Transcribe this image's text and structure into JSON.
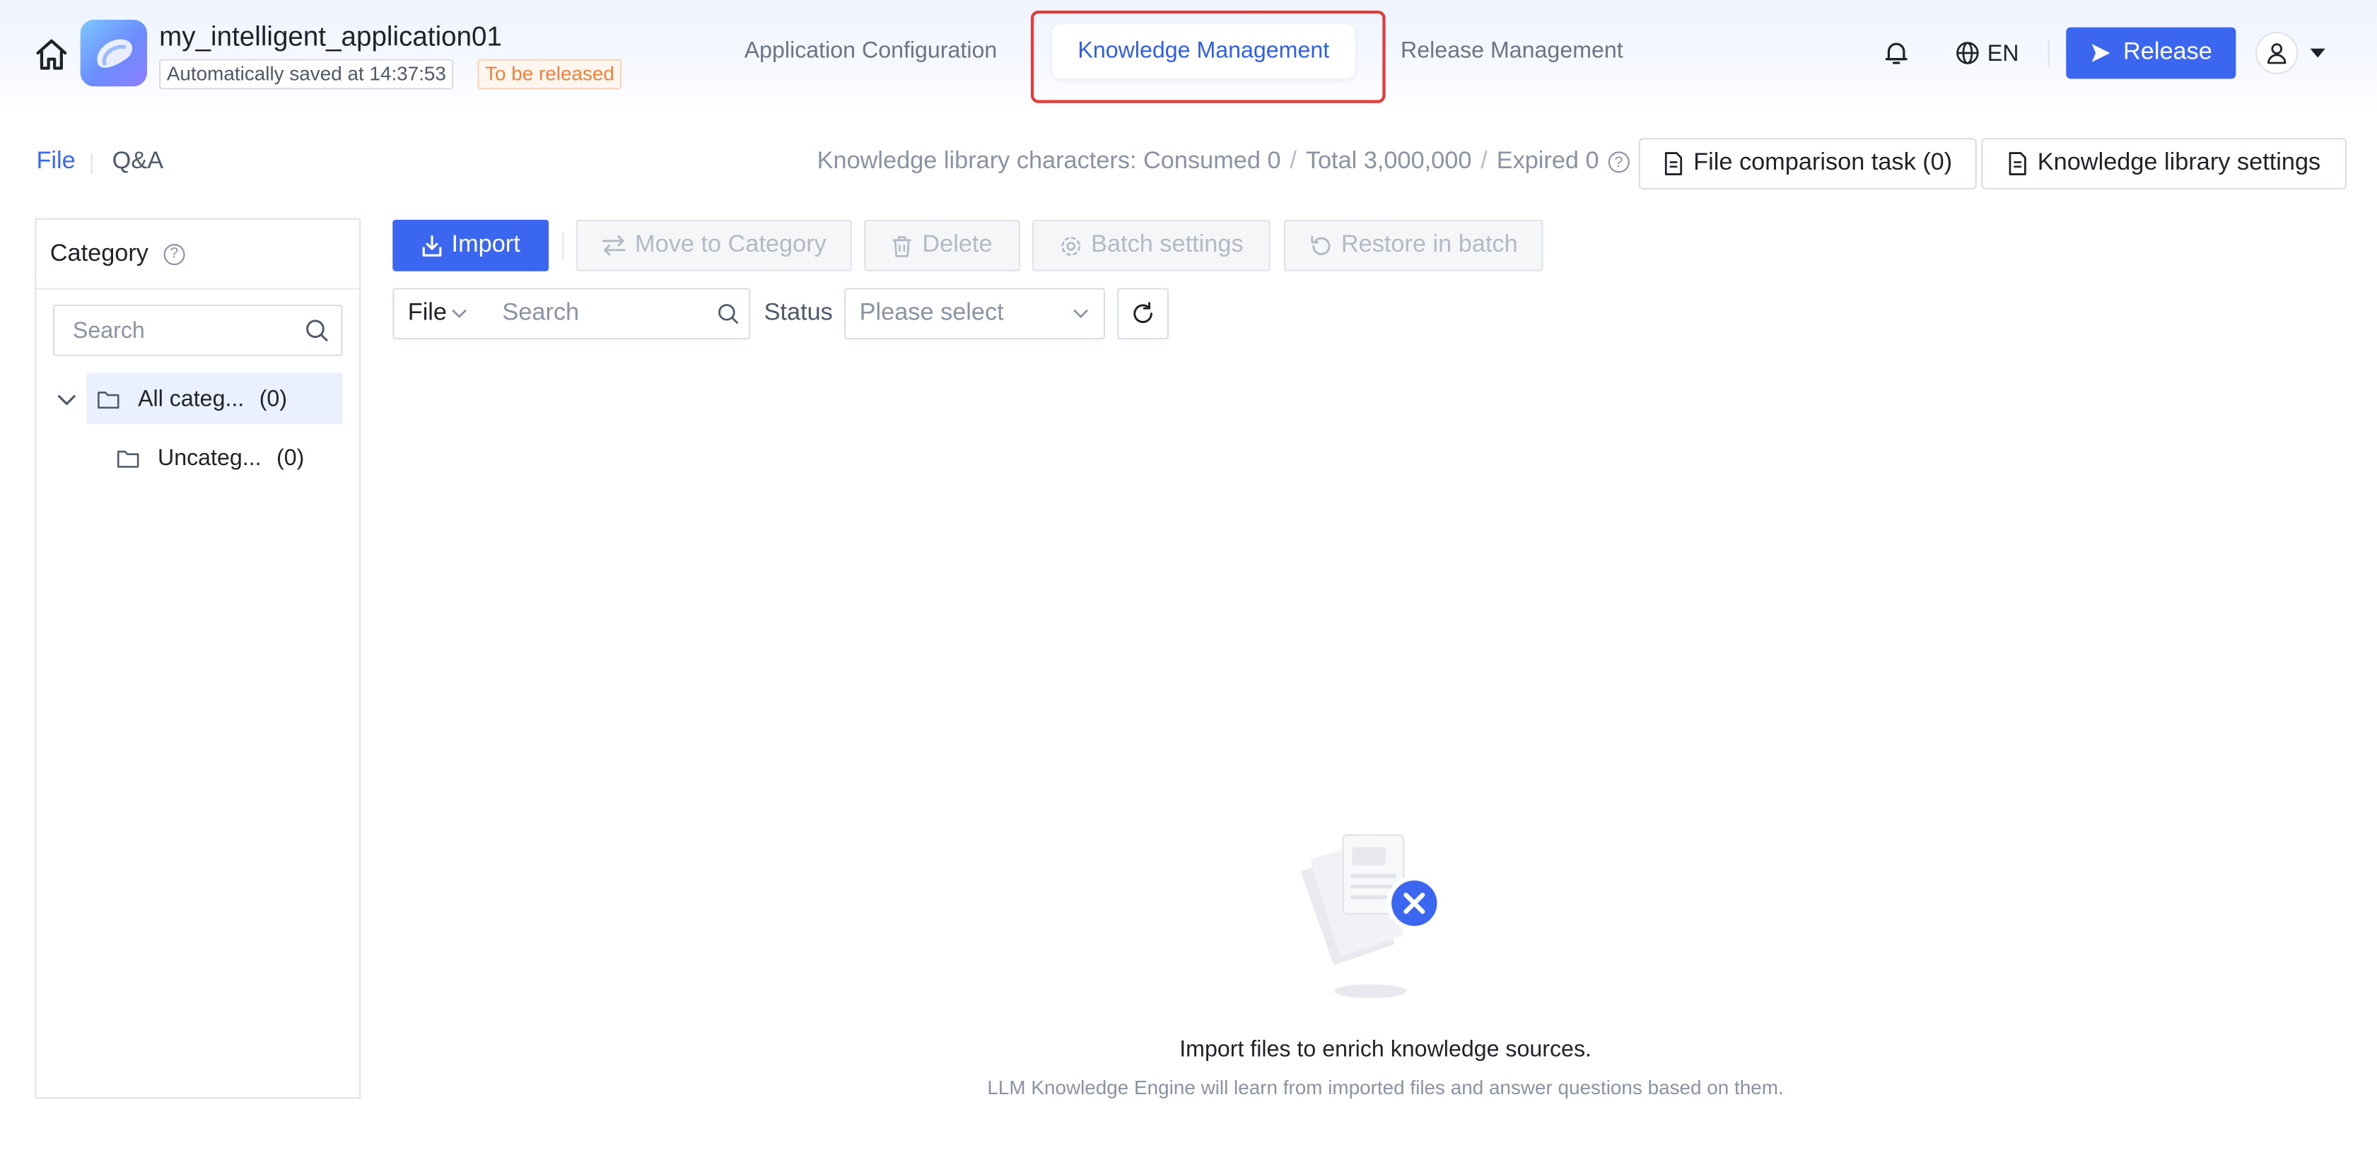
{
  "header": {
    "app_name": "my_intelligent_application01",
    "saved_status": "Automatically saved at 14:37:53",
    "release_status": "To be released",
    "tabs": [
      {
        "label": "Application Configuration",
        "active": false
      },
      {
        "label": "Knowledge Management",
        "active": true
      },
      {
        "label": "Release Management",
        "active": false
      }
    ],
    "language": "EN",
    "release_button": "Release"
  },
  "subheader": {
    "tabs": [
      {
        "label": "File",
        "active": true
      },
      {
        "label": "Q&A",
        "active": false
      }
    ],
    "usage": {
      "consumed": "Knowledge library characters: Consumed 0",
      "total": "Total 3,000,000",
      "expired": "Expired 0"
    },
    "file_comparison_button": "File comparison task (0)",
    "library_settings_button": "Knowledge library settings"
  },
  "category": {
    "title": "Category",
    "search_placeholder": "Search",
    "tree": [
      {
        "label": "All categ...",
        "count": "(0)",
        "expanded": true,
        "selected": true
      },
      {
        "label": "Uncateg...",
        "count": "(0)",
        "expanded": false,
        "selected": false
      }
    ]
  },
  "toolbar": {
    "import": "Import",
    "move_to_category": "Move to Category",
    "delete": "Delete",
    "batch_settings": "Batch settings",
    "restore_in_batch": "Restore in batch"
  },
  "filters": {
    "type_value": "File",
    "search_placeholder": "Search",
    "status_label": "Status",
    "status_placeholder": "Please select"
  },
  "empty_state": {
    "title": "Import files to enrich knowledge sources.",
    "description": "LLM Knowledge Engine will learn from imported files and answer questions based on them."
  },
  "colors": {
    "primary": "#3a66f0",
    "highlight_border": "#e43b3b",
    "release_tag": "#f0803c"
  }
}
